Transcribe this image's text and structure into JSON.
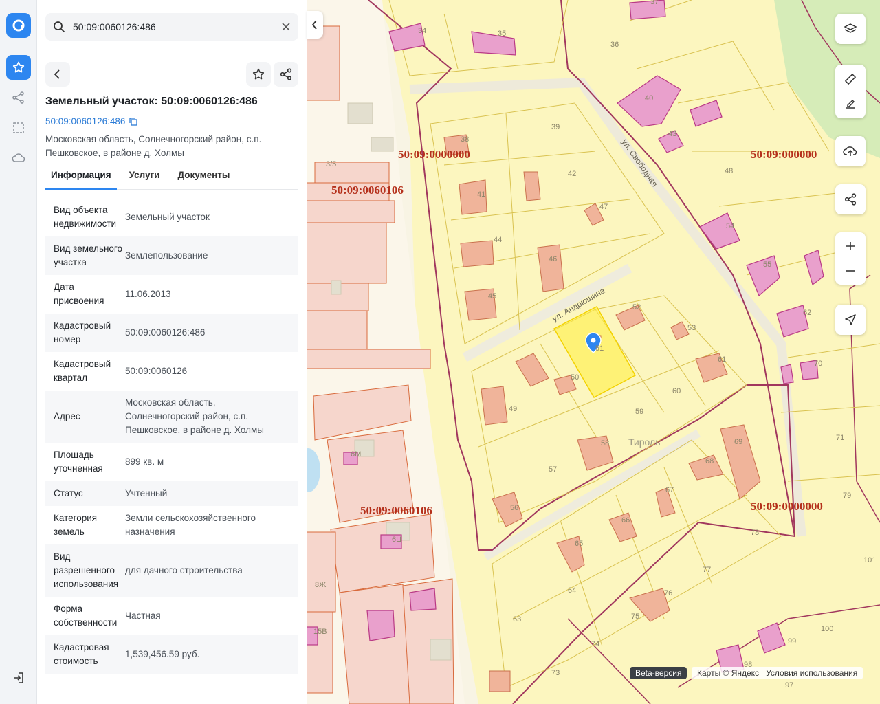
{
  "search": {
    "value": "50:09:0060126:486"
  },
  "parcel": {
    "title": "Земельный участок: 50:09:0060126:486",
    "cad_link": "50:09:0060126:486",
    "address_line": "Московская область, Солнечногорский район, с.п. Пешковское, в районе д. Холмы"
  },
  "tabs": [
    "Информация",
    "Услуги",
    "Документы"
  ],
  "props": [
    {
      "k": "Вид объекта недвижимости",
      "v": "Земельный участок"
    },
    {
      "k": "Вид земельного участка",
      "v": "Землепользование"
    },
    {
      "k": "Дата присвоения",
      "v": "11.06.2013"
    },
    {
      "k": "Кадастровый номер",
      "v": "50:09:0060126:486"
    },
    {
      "k": "Кадастровый квартал",
      "v": "50:09:0060126"
    },
    {
      "k": "Адрес",
      "v": "Московская область, Солнечногорский район, с.п. Пешковское, в районе д. Холмы"
    },
    {
      "k": "Площадь уточненная",
      "v": "899 кв. м"
    },
    {
      "k": "Статус",
      "v": "Учтенный"
    },
    {
      "k": "Категория земель",
      "v": "Земли сельскохозяйственного назначения"
    },
    {
      "k": "Вид разрешенного использования",
      "v": "для дачного строительства"
    },
    {
      "k": "Форма собственности",
      "v": "Частная"
    },
    {
      "k": "Кадастровая стоимость",
      "v": "1,539,456.59 руб."
    }
  ],
  "map": {
    "quarter_labels": [
      "50:09:0000000",
      "50:09:0060106",
      "50:09:0060106",
      "50:09:000000",
      "50:09:0000000"
    ],
    "streets": [
      "ул. Андрюшина",
      "ул. Свободная"
    ],
    "place": "Тироль",
    "plot_numbers": [
      "34",
      "35",
      "37",
      "36",
      "38",
      "39",
      "40",
      "42",
      "43",
      "41",
      "47",
      "44",
      "46",
      "45",
      "48",
      "54",
      "55",
      "52",
      "53",
      "51",
      "50",
      "61",
      "62",
      "60",
      "49",
      "59",
      "58",
      "70",
      "71",
      "69",
      "68",
      "57",
      "67",
      "56",
      "66",
      "65",
      "78",
      "79",
      "77",
      "64",
      "63",
      "76",
      "75",
      "74",
      "100",
      "99",
      "73",
      "98",
      "97",
      "101",
      "3/5",
      "6М",
      "6Ц",
      "8Ж",
      "15В"
    ],
    "beta_label": "Beta-версия",
    "copyright": "Карты © Яндекс",
    "terms": "Условия использования"
  },
  "colors": {
    "accent": "#2d86f0",
    "parcel_fill": "#fff3a0",
    "building": "#e7a0cc",
    "quarter_label": "#b5301b"
  }
}
